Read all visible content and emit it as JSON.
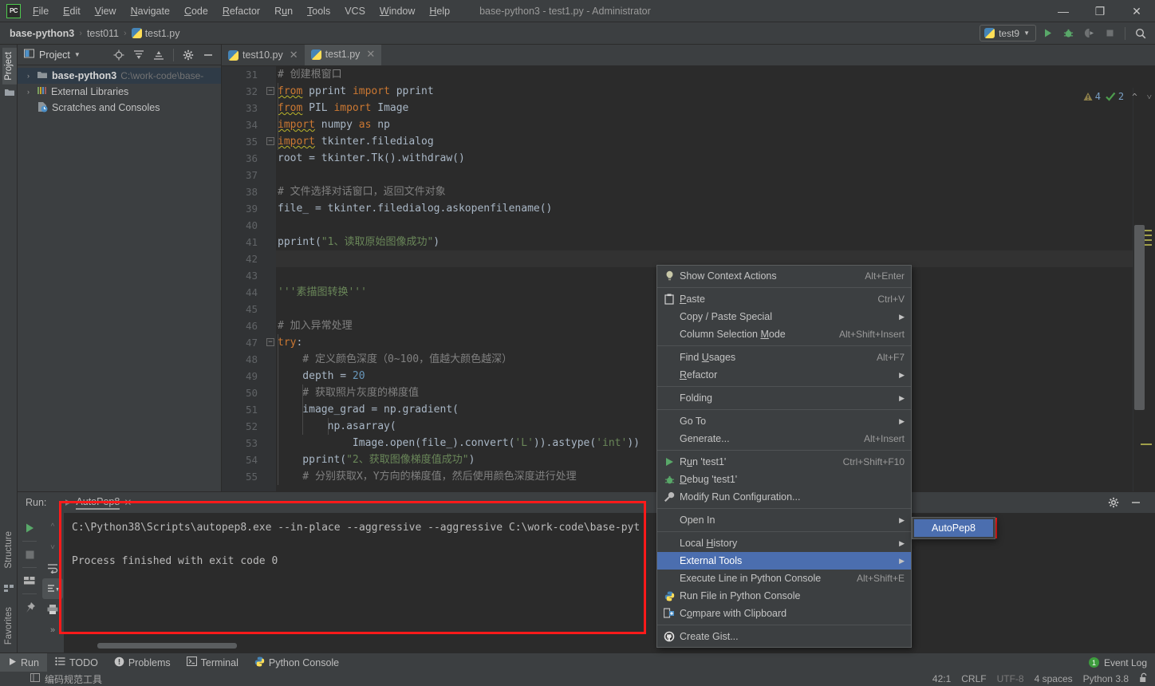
{
  "titlebar": {
    "logo": "PC",
    "menus": [
      {
        "label": "File",
        "accel": "F"
      },
      {
        "label": "Edit",
        "accel": "E"
      },
      {
        "label": "View",
        "accel": "V"
      },
      {
        "label": "Navigate",
        "accel": "N"
      },
      {
        "label": "Code",
        "accel": "C"
      },
      {
        "label": "Refactor",
        "accel": "R"
      },
      {
        "label": "Run",
        "accel": "u"
      },
      {
        "label": "Tools",
        "accel": "T"
      },
      {
        "label": "VCS",
        "accel": ""
      },
      {
        "label": "Window",
        "accel": "W"
      },
      {
        "label": "Help",
        "accel": "H"
      }
    ],
    "window_title": "base-python3 - test1.py - Administrator",
    "minimize": "—",
    "maximize": "❐",
    "close": "✕"
  },
  "navbar": {
    "breadcrumbs": [
      "base-python3",
      "test011",
      "test1.py"
    ],
    "separator": "›",
    "run_config": "test9",
    "buttons": [
      "run-button",
      "debug-button",
      "run-with-coverage-button",
      "stop-button",
      "search-everywhere-button"
    ]
  },
  "left_strip": {
    "tabs": [
      "Project",
      "Structure",
      "Favorites"
    ]
  },
  "project_panel": {
    "title": "Project",
    "tree": [
      {
        "label": "base-python3",
        "path": "C:\\work-code\\base-",
        "bold": true,
        "arrow": "›",
        "icon": "folder-icon",
        "selected": true
      },
      {
        "label": "External Libraries",
        "path": "",
        "bold": false,
        "arrow": "›",
        "icon": "libraries-icon",
        "selected": false
      },
      {
        "label": "Scratches and Consoles",
        "path": "",
        "bold": false,
        "arrow": "",
        "icon": "scratches-icon",
        "selected": false
      }
    ]
  },
  "editor": {
    "tabs": [
      {
        "label": "test10.py",
        "active": false
      },
      {
        "label": "test1.py",
        "active": true
      }
    ],
    "first_line_number": 31,
    "inspections": {
      "warnings": "4",
      "checks": "2"
    },
    "lines": [
      {
        "n": 31,
        "tokens": [
          {
            "t": "# 创建根窗口",
            "c": "cmt"
          }
        ]
      },
      {
        "n": 32,
        "fold": "minus",
        "tokens": [
          {
            "t": "from",
            "c": "kw squig"
          },
          {
            "t": " pprint ",
            "c": ""
          },
          {
            "t": "import",
            "c": "kw"
          },
          {
            "t": " pprint",
            "c": ""
          }
        ]
      },
      {
        "n": 33,
        "tokens": [
          {
            "t": "from",
            "c": "kw squig"
          },
          {
            "t": " PIL ",
            "c": ""
          },
          {
            "t": "import",
            "c": "kw"
          },
          {
            "t": " Image",
            "c": ""
          }
        ]
      },
      {
        "n": 34,
        "tokens": [
          {
            "t": "import",
            "c": "kw squig"
          },
          {
            "t": " numpy ",
            "c": ""
          },
          {
            "t": "as",
            "c": "kw"
          },
          {
            "t": " np",
            "c": ""
          }
        ]
      },
      {
        "n": 35,
        "fold": "minus",
        "tokens": [
          {
            "t": "import",
            "c": "kw squig"
          },
          {
            "t": " tkinter.filedialog",
            "c": ""
          }
        ]
      },
      {
        "n": 36,
        "tokens": [
          {
            "t": "root = tkinter.Tk().withdraw()",
            "c": ""
          }
        ]
      },
      {
        "n": 37,
        "tokens": []
      },
      {
        "n": 38,
        "tokens": [
          {
            "t": "# 文件选择对话窗口，返回文件对象",
            "c": "cmt"
          }
        ]
      },
      {
        "n": 39,
        "tokens": [
          {
            "t": "file_ = tkinter.filedialog.askopenfilename()",
            "c": ""
          }
        ]
      },
      {
        "n": 40,
        "tokens": []
      },
      {
        "n": 41,
        "tokens": [
          {
            "t": "pprint(",
            "c": ""
          },
          {
            "t": "\"1、读取原始图像成功\"",
            "c": "str"
          },
          {
            "t": ")",
            "c": ""
          }
        ]
      },
      {
        "n": 42,
        "current": true,
        "tokens": []
      },
      {
        "n": 43,
        "tokens": []
      },
      {
        "n": 44,
        "tokens": [
          {
            "t": "'''素描图转换'''",
            "c": "str"
          }
        ]
      },
      {
        "n": 45,
        "tokens": []
      },
      {
        "n": 46,
        "tokens": [
          {
            "t": "# 加入异常处理",
            "c": "cmt"
          }
        ]
      },
      {
        "n": 47,
        "fold": "minus",
        "tokens": [
          {
            "t": "try",
            "c": "kw"
          },
          {
            "t": ":",
            "c": ""
          }
        ]
      },
      {
        "n": 48,
        "tokens": [
          {
            "t": "    # 定义颜色深度（0~100，值越大颜色越深）",
            "c": "cmt"
          }
        ]
      },
      {
        "n": 49,
        "tokens": [
          {
            "t": "    depth = ",
            "c": ""
          },
          {
            "t": "20",
            "c": "num"
          }
        ]
      },
      {
        "n": 50,
        "tokens": [
          {
            "t": "    # 获取照片灰度的梯度值",
            "c": "cmt"
          }
        ]
      },
      {
        "n": 51,
        "tokens": [
          {
            "t": "    image_grad = np.gradient(",
            "c": ""
          }
        ]
      },
      {
        "n": 52,
        "tokens": [
          {
            "t": "        np.asarray(",
            "c": ""
          }
        ]
      },
      {
        "n": 53,
        "tokens": [
          {
            "t": "            Image.open(file_).convert(",
            "c": ""
          },
          {
            "t": "'L'",
            "c": "str"
          },
          {
            "t": ")).astype(",
            "c": ""
          },
          {
            "t": "'int'",
            "c": "str"
          },
          {
            "t": "))",
            "c": ""
          }
        ]
      },
      {
        "n": 54,
        "tokens": [
          {
            "t": "    pprint(",
            "c": ""
          },
          {
            "t": "\"2、获取图像梯度值成功\"",
            "c": "str"
          },
          {
            "t": ")",
            "c": ""
          }
        ]
      },
      {
        "n": 55,
        "tokens": [
          {
            "t": "    # 分别获取X，Y方向的梯度值，然后使用颜色深度进行处理",
            "c": "cmt"
          }
        ]
      }
    ]
  },
  "context_menu": {
    "items": [
      {
        "label": "Show Context Actions",
        "shortcut": "Alt+Enter",
        "icon": "lightbulb-icon",
        "submenu": false,
        "selected": false
      },
      {
        "sep": true
      },
      {
        "label": "Paste",
        "accel": "P",
        "shortcut": "Ctrl+V",
        "icon": "clipboard-icon",
        "submenu": false,
        "selected": false
      },
      {
        "label": "Copy / Paste Special",
        "shortcut": "",
        "icon": "",
        "submenu": true,
        "selected": false
      },
      {
        "label": "Column Selection Mode",
        "accel": "M",
        "shortcut": "Alt+Shift+Insert",
        "icon": "",
        "submenu": false,
        "selected": false
      },
      {
        "sep": true
      },
      {
        "label": "Find Usages",
        "accel": "U",
        "shortcut": "Alt+F7",
        "icon": "",
        "submenu": false,
        "selected": false
      },
      {
        "label": "Refactor",
        "accel": "R",
        "shortcut": "",
        "icon": "",
        "submenu": true,
        "selected": false
      },
      {
        "sep": true
      },
      {
        "label": "Folding",
        "shortcut": "",
        "icon": "",
        "submenu": true,
        "selected": false
      },
      {
        "sep": true
      },
      {
        "label": "Go To",
        "shortcut": "",
        "icon": "",
        "submenu": true,
        "selected": false
      },
      {
        "label": "Generate...",
        "shortcut": "Alt+Insert",
        "icon": "",
        "submenu": false,
        "selected": false
      },
      {
        "sep": true
      },
      {
        "label": "Run 'test1'",
        "accel": "u",
        "shortcut": "Ctrl+Shift+F10",
        "icon": "run-icon",
        "submenu": false,
        "selected": false
      },
      {
        "label": "Debug 'test1'",
        "accel": "D",
        "shortcut": "",
        "icon": "debug-icon",
        "submenu": false,
        "selected": false
      },
      {
        "label": "Modify Run Configuration...",
        "shortcut": "",
        "icon": "wrench-icon",
        "submenu": false,
        "selected": false
      },
      {
        "sep": true
      },
      {
        "label": "Open In",
        "shortcut": "",
        "icon": "",
        "submenu": true,
        "selected": false
      },
      {
        "sep": true
      },
      {
        "label": "Local History",
        "accel": "H",
        "shortcut": "",
        "icon": "",
        "submenu": true,
        "selected": false
      },
      {
        "label": "External Tools",
        "shortcut": "",
        "icon": "",
        "submenu": true,
        "selected": true
      },
      {
        "label": "Execute Line in Python Console",
        "shortcut": "Alt+Shift+E",
        "icon": "",
        "submenu": false,
        "selected": false
      },
      {
        "label": "Run File in Python Console",
        "shortcut": "",
        "icon": "python-icon",
        "submenu": false,
        "selected": false
      },
      {
        "label": "Compare with Clipboard",
        "accel": "o",
        "shortcut": "",
        "icon": "compare-icon",
        "submenu": false,
        "selected": false
      },
      {
        "sep": true
      },
      {
        "label": "Create Gist...",
        "shortcut": "",
        "icon": "github-icon",
        "submenu": false,
        "selected": false
      }
    ]
  },
  "submenu": {
    "items": [
      {
        "label": "AutoPep8",
        "selected": true
      }
    ]
  },
  "run_panel": {
    "label": "Run:",
    "tab": "AutoPep8",
    "console_lines": [
      "C:\\Python38\\Scripts\\autopep8.exe --in-place --aggressive --aggressive C:\\work-code\\base-pyt",
      "",
      "Process finished with exit code 0"
    ]
  },
  "bottom_bar": {
    "items": [
      {
        "label": "Run",
        "icon": "run-icon",
        "active": true
      },
      {
        "label": "TODO",
        "icon": "todo-icon",
        "active": false
      },
      {
        "label": "Problems",
        "icon": "problems-icon",
        "active": false
      },
      {
        "label": "Terminal",
        "icon": "terminal-icon",
        "active": false
      },
      {
        "label": "Python Console",
        "icon": "python-icon",
        "active": false
      }
    ],
    "event_log": {
      "label": "Event Log",
      "count": "1"
    }
  },
  "status_bar": {
    "left_text": "编码规范工具",
    "caret": "42:1",
    "line_sep": "CRLF",
    "encoding": "UTF-8",
    "indent": "4 spaces",
    "interpreter": "Python 3.8",
    "lock_icon": "unlocked-icon"
  },
  "colors": {
    "accent_blue": "#2f5fd4",
    "menu_highlight": "#4b6eaf",
    "highlight_red": "#ff1a1a",
    "panel_bg": "#3c3f41",
    "editor_bg": "#2b2b2b"
  }
}
